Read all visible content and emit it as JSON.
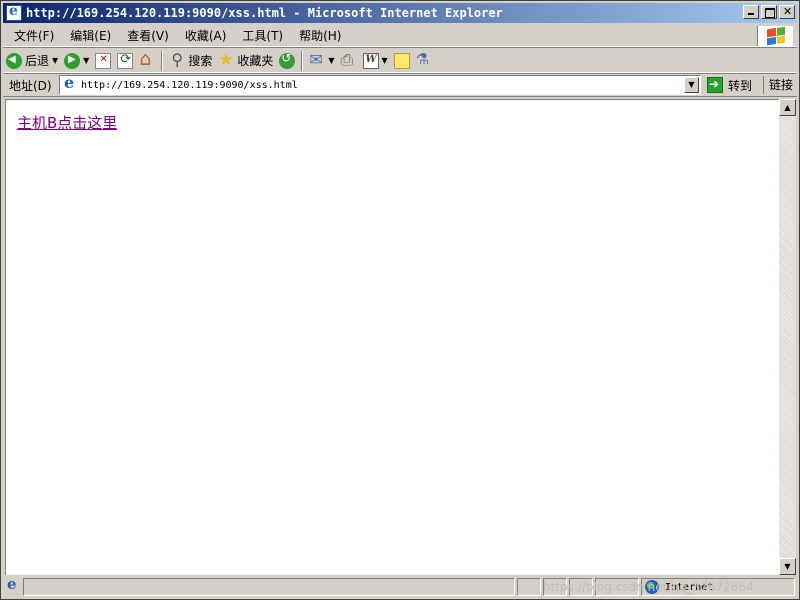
{
  "window": {
    "title": "http://169.254.120.119:9090/xss.html - Microsoft Internet Explorer"
  },
  "menu": {
    "items": [
      "文件(F)",
      "编辑(E)",
      "查看(V)",
      "收藏(A)",
      "工具(T)",
      "帮助(H)"
    ]
  },
  "toolbar": {
    "back_label": "后退",
    "search_label": "搜索",
    "favorites_label": "收藏夹"
  },
  "address": {
    "label": "地址(D)",
    "url": "http://169.254.120.119:9090/xss.html",
    "go_label": "转到",
    "links_label": "链接"
  },
  "content": {
    "link_text": "主机B点击这里",
    "link_color": "#800080"
  },
  "status": {
    "zone": "Internet",
    "watermark": "https://blog.csdn.net/qq_37672864"
  },
  "colors": {
    "titlebar_start": "#0a246a",
    "titlebar_end": "#a6caf0",
    "chrome": "#d4d0c8"
  },
  "icons": {
    "title": "ie-icon",
    "back": "back-arrow-icon",
    "forward": "forward-arrow-icon",
    "stop": "stop-icon",
    "refresh": "refresh-icon",
    "home": "home-icon",
    "search": "search-icon",
    "favorites": "star-icon",
    "history": "history-icon",
    "mail": "mail-icon",
    "print": "print-icon",
    "edit": "edit-icon",
    "discuss": "note-icon",
    "research": "research-icon",
    "zone": "globe-icon"
  }
}
